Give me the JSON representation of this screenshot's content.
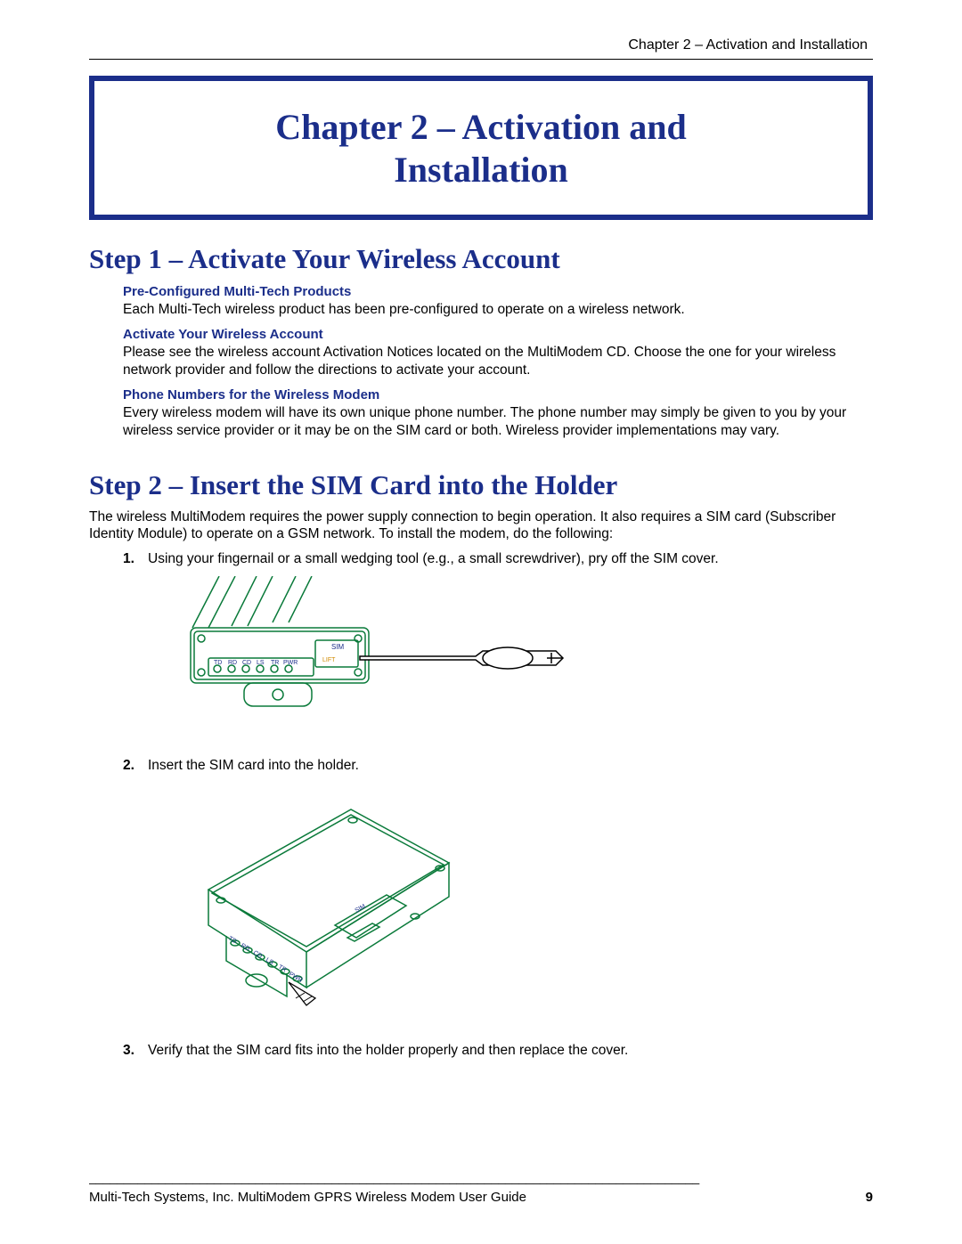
{
  "header": "Chapter 2 – Activation and Installation",
  "chapter_title_line1": "Chapter 2 – Activation and",
  "chapter_title_line2": "Installation",
  "step1_title": "Step 1 – Activate Your Wireless Account",
  "sections": {
    "preconf": {
      "head": "Pre-Configured Multi-Tech Products",
      "body": "Each Multi-Tech wireless product has been pre-configured to operate on a wireless network."
    },
    "activate": {
      "head": "Activate Your Wireless Account",
      "body": "Please see the wireless account Activation Notices located on the MultiModem CD. Choose the one for your wireless network provider and follow the directions to activate your account."
    },
    "phone": {
      "head": "Phone Numbers for the Wireless Modem",
      "body": "Every wireless modem will have its own unique phone number. The phone number may simply be given to you by your wireless service provider or it may be on the SIM card or both. Wireless provider implementations may vary."
    }
  },
  "step2_title": "Step 2 – Insert the SIM Card into the Holder",
  "step2_intro": "The wireless MultiModem requires the power supply connection to begin operation.  It also requires a SIM card (Subscriber Identity Module) to operate on a GSM network. To install the modem, do the following:",
  "list": {
    "n1": "1.",
    "t1": "Using your fingernail or a small wedging tool (e.g., a small screwdriver), pry off the SIM cover.",
    "n2": "2.",
    "t2": "Insert the SIM card into the holder.",
    "n3": "3.",
    "t3": "Verify that the SIM card fits into the holder properly and then replace the cover."
  },
  "device_labels": {
    "leds": [
      "TD",
      "RD",
      "CD",
      "LS",
      "TR",
      "PWR"
    ],
    "sim": "SIM",
    "lift": "LIFT"
  },
  "footer_dashes": "________________________________________________________________________________________",
  "footer_text": "Multi-Tech Systems, Inc. MultiModem GPRS Wireless Modem User Guide",
  "page_num": "9"
}
